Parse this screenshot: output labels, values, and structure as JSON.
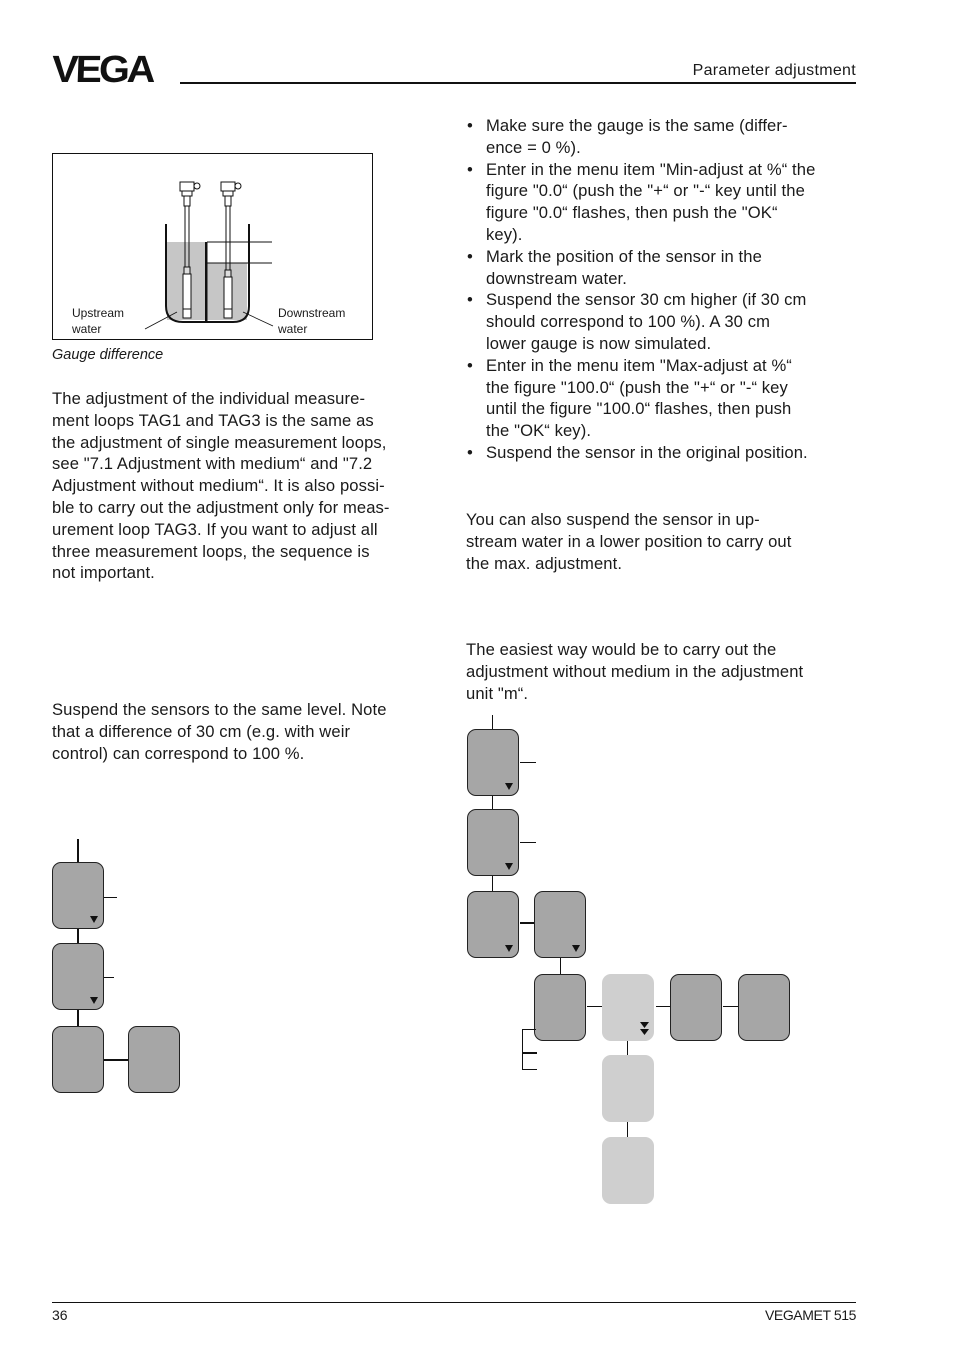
{
  "header": {
    "logo": "VEGA",
    "section_title": "Parameter adjustment"
  },
  "figure": {
    "label_upstream_line1": "Upstream",
    "label_upstream_line2": "water",
    "label_downstream_line1": "Downstream",
    "label_downstream_line2": "water",
    "caption": "Gauge difference"
  },
  "left_column": {
    "para1": "The adjustment of the individual measure-ment loops TAG1 and TAG3 is the same as the adjustment of single measurement loops, see \"7.1 Adjustment with medium“ and \"7.2 Adjustment without medium“. It is also possi-ble to carry out the adjustment only for meas-urement loop TAG3. If you want to adjust all three measurement loops, the sequence is not important.",
    "para1_lines": [
      "The adjustment of the individual measure-",
      "ment loops TAG1 and TAG3 is the same as",
      "the adjustment of single measurement loops,",
      "see \"7.1 Adjustment with medium“ and \"7.2",
      "Adjustment without medium“. It is also possi-",
      "ble to carry out the adjustment only for meas-",
      "urement loop TAG3. If you want to adjust all",
      "three measurement loops, the sequence is",
      "not important."
    ],
    "para2_lines": [
      "Suspend the sensors to the same level. Note",
      "that a difference of 30 cm (e.g. with weir",
      "control) can correspond to 100 %."
    ]
  },
  "right_column": {
    "bullets": [
      [
        "Make sure the gauge is the same (differ-",
        "ence = 0 %)."
      ],
      [
        "Enter in the menu item \"Min-adjust at %“ the",
        "figure \"0.0“ (push the \"+“ or \"-“ key until the",
        "figure \"0.0“ flashes, then push the \"OK“",
        "key)."
      ],
      [
        "Mark the position of the sensor in the",
        "downstream water."
      ],
      [
        "Suspend the sensor 30 cm higher (if 30 cm",
        "should correspond to 100 %). A 30 cm",
        "lower gauge is now simulated."
      ],
      [
        "Enter in the menu item \"Max-adjust at %“",
        "the figure \"100.0“  (push the \"+“ or \"-“ key",
        "until the figure \"100.0“ flashes, then push",
        "the \"OK“ key)."
      ],
      [
        "Suspend the sensor in the original position."
      ]
    ],
    "para_alt_lines": [
      "You can also suspend the sensor in up-",
      "stream water in a lower position to carry out",
      "the max. adjustment."
    ],
    "para_easiest_lines": [
      "The easiest way would be to carry out the",
      "adjustment without medium in the adjustment",
      "unit \"m“."
    ]
  },
  "footer": {
    "page_number": "36",
    "product": "VEGAMET 515"
  }
}
